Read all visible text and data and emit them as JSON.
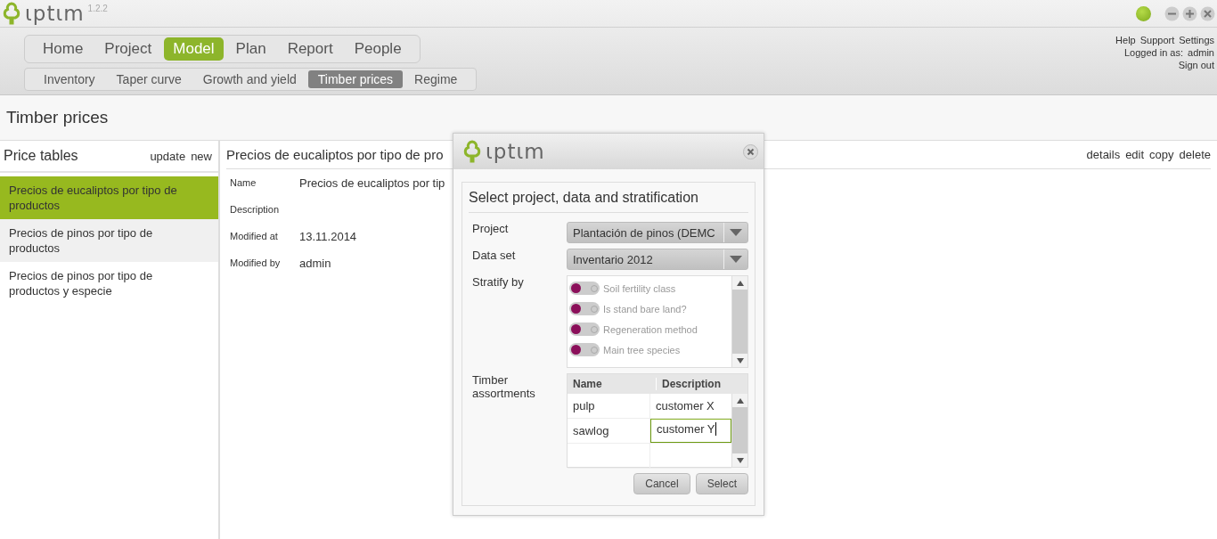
{
  "app": {
    "logo": "ιptιm",
    "version": "1.2.2"
  },
  "top_links": [
    "Help",
    "Support",
    "Settings"
  ],
  "login": {
    "label": "Logged in as:",
    "user": "admin",
    "sign_out": "Sign out"
  },
  "main_nav": [
    {
      "label": "Home",
      "selected": false
    },
    {
      "label": "Project",
      "selected": false
    },
    {
      "label": "Model",
      "selected": true
    },
    {
      "label": "Plan",
      "selected": false
    },
    {
      "label": "Report",
      "selected": false
    },
    {
      "label": "People",
      "selected": false
    }
  ],
  "sub_nav": [
    {
      "label": "Inventory",
      "selected": false
    },
    {
      "label": "Taper curve",
      "selected": false
    },
    {
      "label": "Growth and yield",
      "selected": false
    },
    {
      "label": "Timber prices",
      "selected": true
    },
    {
      "label": "Regime",
      "selected": false
    }
  ],
  "page_title": "Timber prices",
  "sidebar": {
    "title": "Price tables",
    "actions": [
      "update",
      "new"
    ],
    "items": [
      {
        "label": "Precios de eucaliptos por tipo de productos",
        "selected": true
      },
      {
        "label": "Precios de pinos por tipo de productos",
        "selected": false
      },
      {
        "label": "Precios de pinos por tipo de productos y especie",
        "selected": false
      }
    ]
  },
  "detail": {
    "title": "Precios de eucaliptos por tipo de pro",
    "actions": [
      "details",
      "edit",
      "copy",
      "delete"
    ],
    "fields": [
      {
        "label": "Name",
        "value": "Precios de eucaliptos por tip"
      },
      {
        "label": "Description"
      },
      {
        "label": "Modified at",
        "value": "13.11.2014"
      },
      {
        "label": "Modified by",
        "value": "admin"
      }
    ]
  },
  "dialog": {
    "logo": "ιptιm",
    "title": "Select project, data and stratification",
    "project": {
      "label": "Project",
      "value": "Plantación de pinos (DEMC"
    },
    "data_set": {
      "label": "Data set",
      "value": "Inventario 2012"
    },
    "stratify": {
      "label": "Stratify by",
      "items": [
        {
          "label": "Soil fertility class",
          "on": false
        },
        {
          "label": "Is stand bare land?",
          "on": false
        },
        {
          "label": "Regeneration method",
          "on": false
        },
        {
          "label": "Main tree species",
          "on": false
        }
      ]
    },
    "assortments": {
      "label": "Timber assortments",
      "columns": [
        "Name",
        "Description"
      ],
      "rows": [
        {
          "name": "pulp",
          "description": "customer X",
          "editing": false
        },
        {
          "name": "sawlog",
          "description": "customer Y",
          "editing": true
        }
      ]
    },
    "buttons": [
      "Cancel",
      "Select"
    ]
  }
}
